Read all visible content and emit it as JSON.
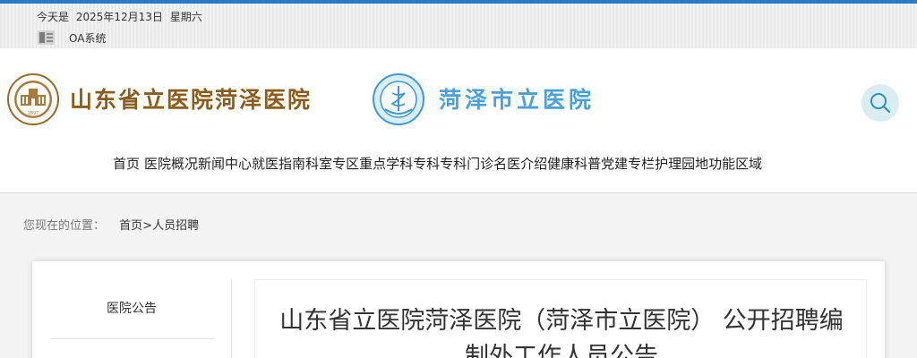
{
  "topbar": {
    "date_prefix": "今天是",
    "date": "2025年12月13日",
    "weekday": "星期六",
    "oa_label": "OA系统"
  },
  "header": {
    "hospital_name": "山东省立医院菏泽医院",
    "city_hospital_name": "菏泽市立医院",
    "seal_year": "1897"
  },
  "nav": {
    "items": [
      "首页",
      "医院概况",
      "新闻中心",
      "就医指南",
      "科室专区",
      "重点学科",
      "专科专科门诊",
      "名医介绍",
      "健康科普",
      "党建专栏",
      "护理园地",
      "功能区域"
    ]
  },
  "breadcrumb": {
    "label": "您现在的位置：",
    "home": "首页",
    "separator": ">",
    "current": "人员招聘"
  },
  "sidebar": {
    "title": "医院公告"
  },
  "article": {
    "title": "山东省立医院菏泽医院（菏泽市立医院） 公开招聘编制外工作人员公告"
  },
  "colors": {
    "accent_blue": "#2b79c2",
    "brand_brown": "#8a5d1c",
    "brand_light_blue": "#4aa0d8",
    "search_bg": "#d9edf2"
  }
}
